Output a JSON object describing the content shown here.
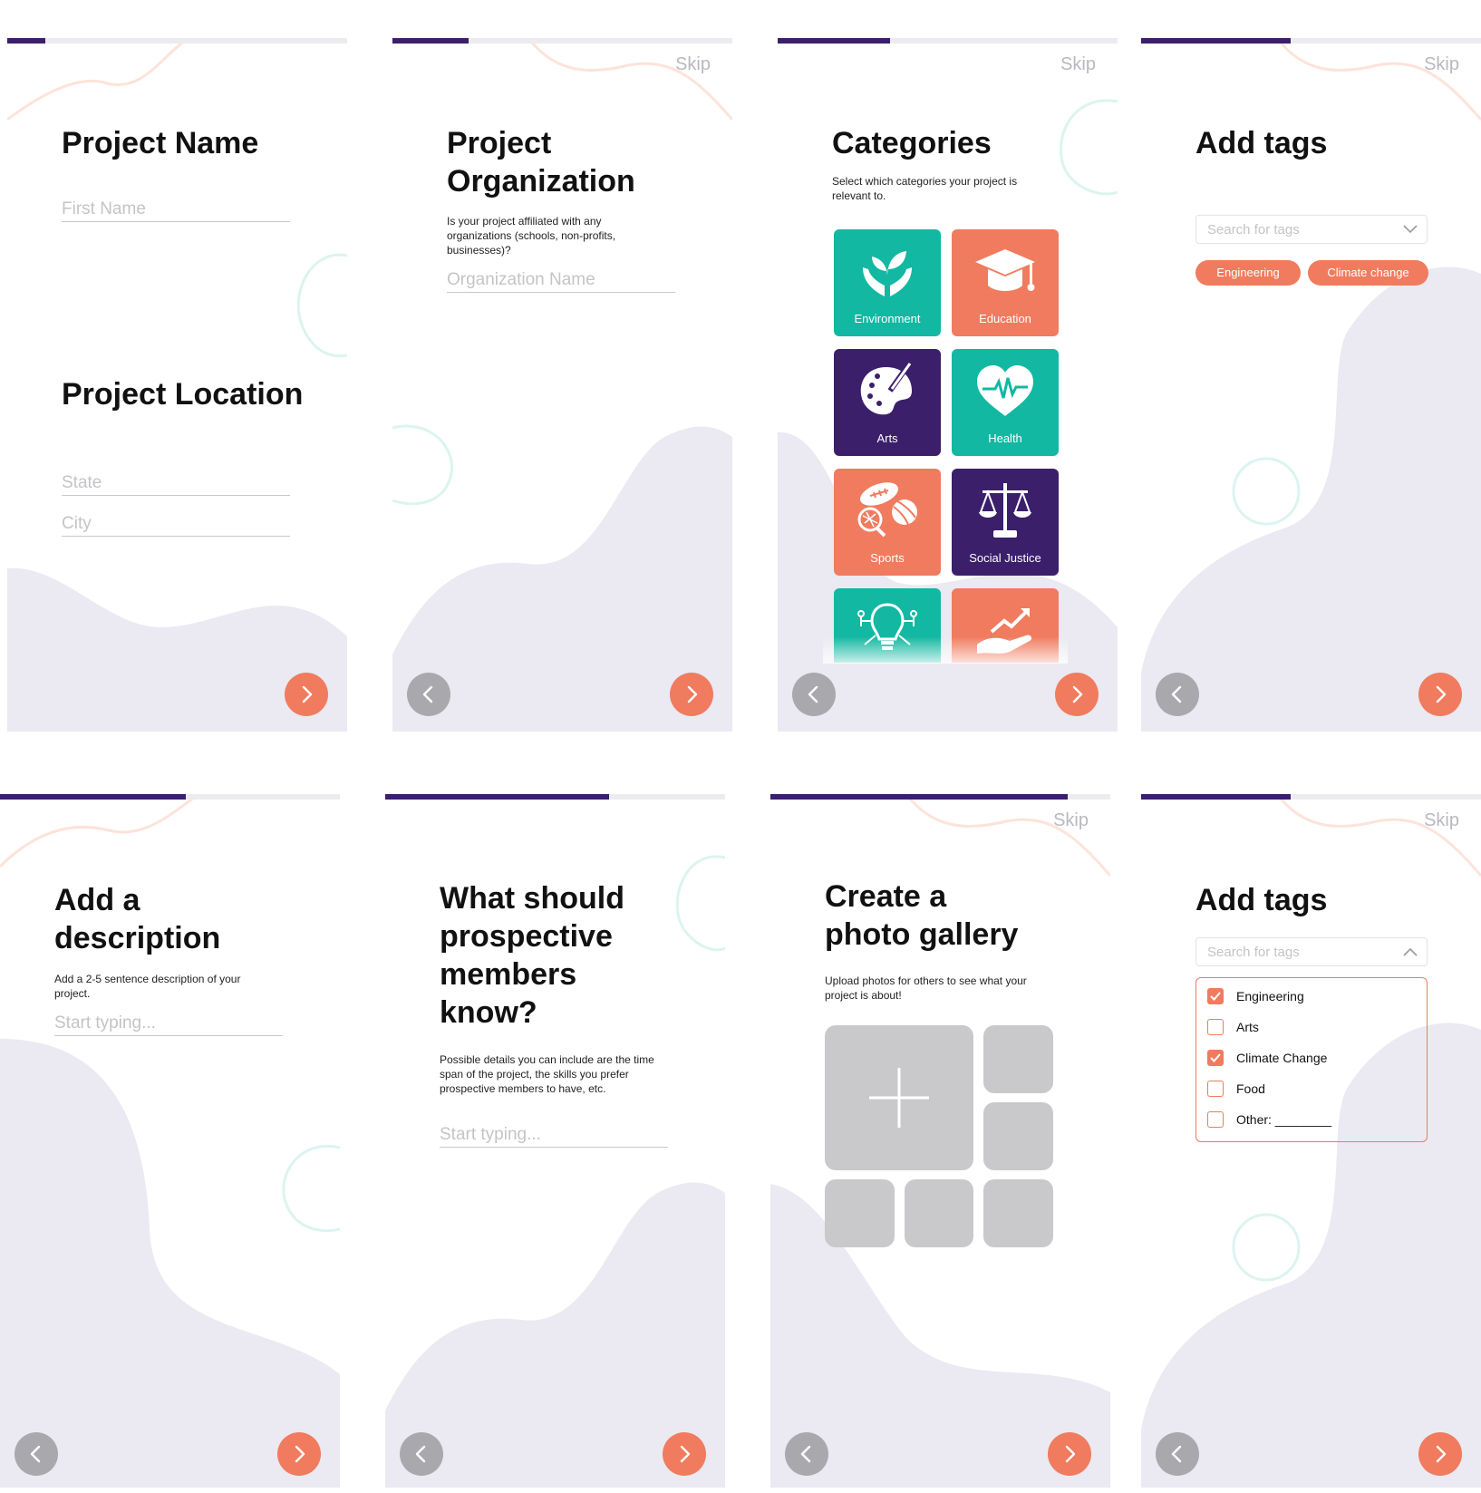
{
  "colors": {
    "accent": "#f07b5e",
    "brand": "#3b1f6b",
    "teal": "#12b8a2",
    "blob": "#ebe9f1",
    "disabled": "#a9a9ad"
  },
  "skip_label": "Skip",
  "screens": [
    {
      "progress": 0.11,
      "title1": "Project Name",
      "field_first_name": "First Name",
      "title2": "Project Location",
      "field_state": "State",
      "field_city": "City"
    },
    {
      "progress": 0.22,
      "title": "Project Organization",
      "subtitle": "Is your project affiliated with any organizations (schools, non-profits, businesses)?",
      "field_org": "Organization Name"
    },
    {
      "progress": 0.33,
      "title": "Categories",
      "subtitle": "Select which categories your project is relevant to.",
      "categories": [
        {
          "label": "Environment",
          "icon": "plant-hands-icon"
        },
        {
          "label": "Education",
          "icon": "graduation-cap-icon"
        },
        {
          "label": "Arts",
          "icon": "palette-icon"
        },
        {
          "label": "Health",
          "icon": "heartbeat-icon"
        },
        {
          "label": "Sports",
          "icon": "sports-balls-icon"
        },
        {
          "label": "Social Justice",
          "icon": "scales-icon"
        },
        {
          "label": "",
          "icon": "lightbulb-circuit-icon"
        },
        {
          "label": "",
          "icon": "hand-growth-icon"
        }
      ]
    },
    {
      "progress": 0.44,
      "title": "Add tags",
      "search_placeholder": "Search for tags",
      "tags": [
        "Engineering",
        "Climate change"
      ]
    },
    {
      "progress": 0.55,
      "title": "Add a description",
      "subtitle": "Add a 2-5 sentence description of your project.",
      "field": "Start typing..."
    },
    {
      "progress": 0.66,
      "title": "What should prospective members know?",
      "subtitle": "Possible details you can include are  the time span of the project,  the skills you prefer prospective members to have, etc.",
      "field": "Start typing..."
    },
    {
      "progress": 0.88,
      "title": "Create  a photo gallery",
      "subtitle": "Upload photos for others to see what your project is about!"
    },
    {
      "progress": 0.44,
      "title": "Add tags",
      "search_placeholder": "Search for tags",
      "options": [
        {
          "label": "Engineering",
          "checked": true
        },
        {
          "label": "Arts",
          "checked": false
        },
        {
          "label": "Climate Change",
          "checked": true
        },
        {
          "label": "Food",
          "checked": false
        },
        {
          "label": "Other: ________",
          "checked": false
        }
      ]
    }
  ]
}
